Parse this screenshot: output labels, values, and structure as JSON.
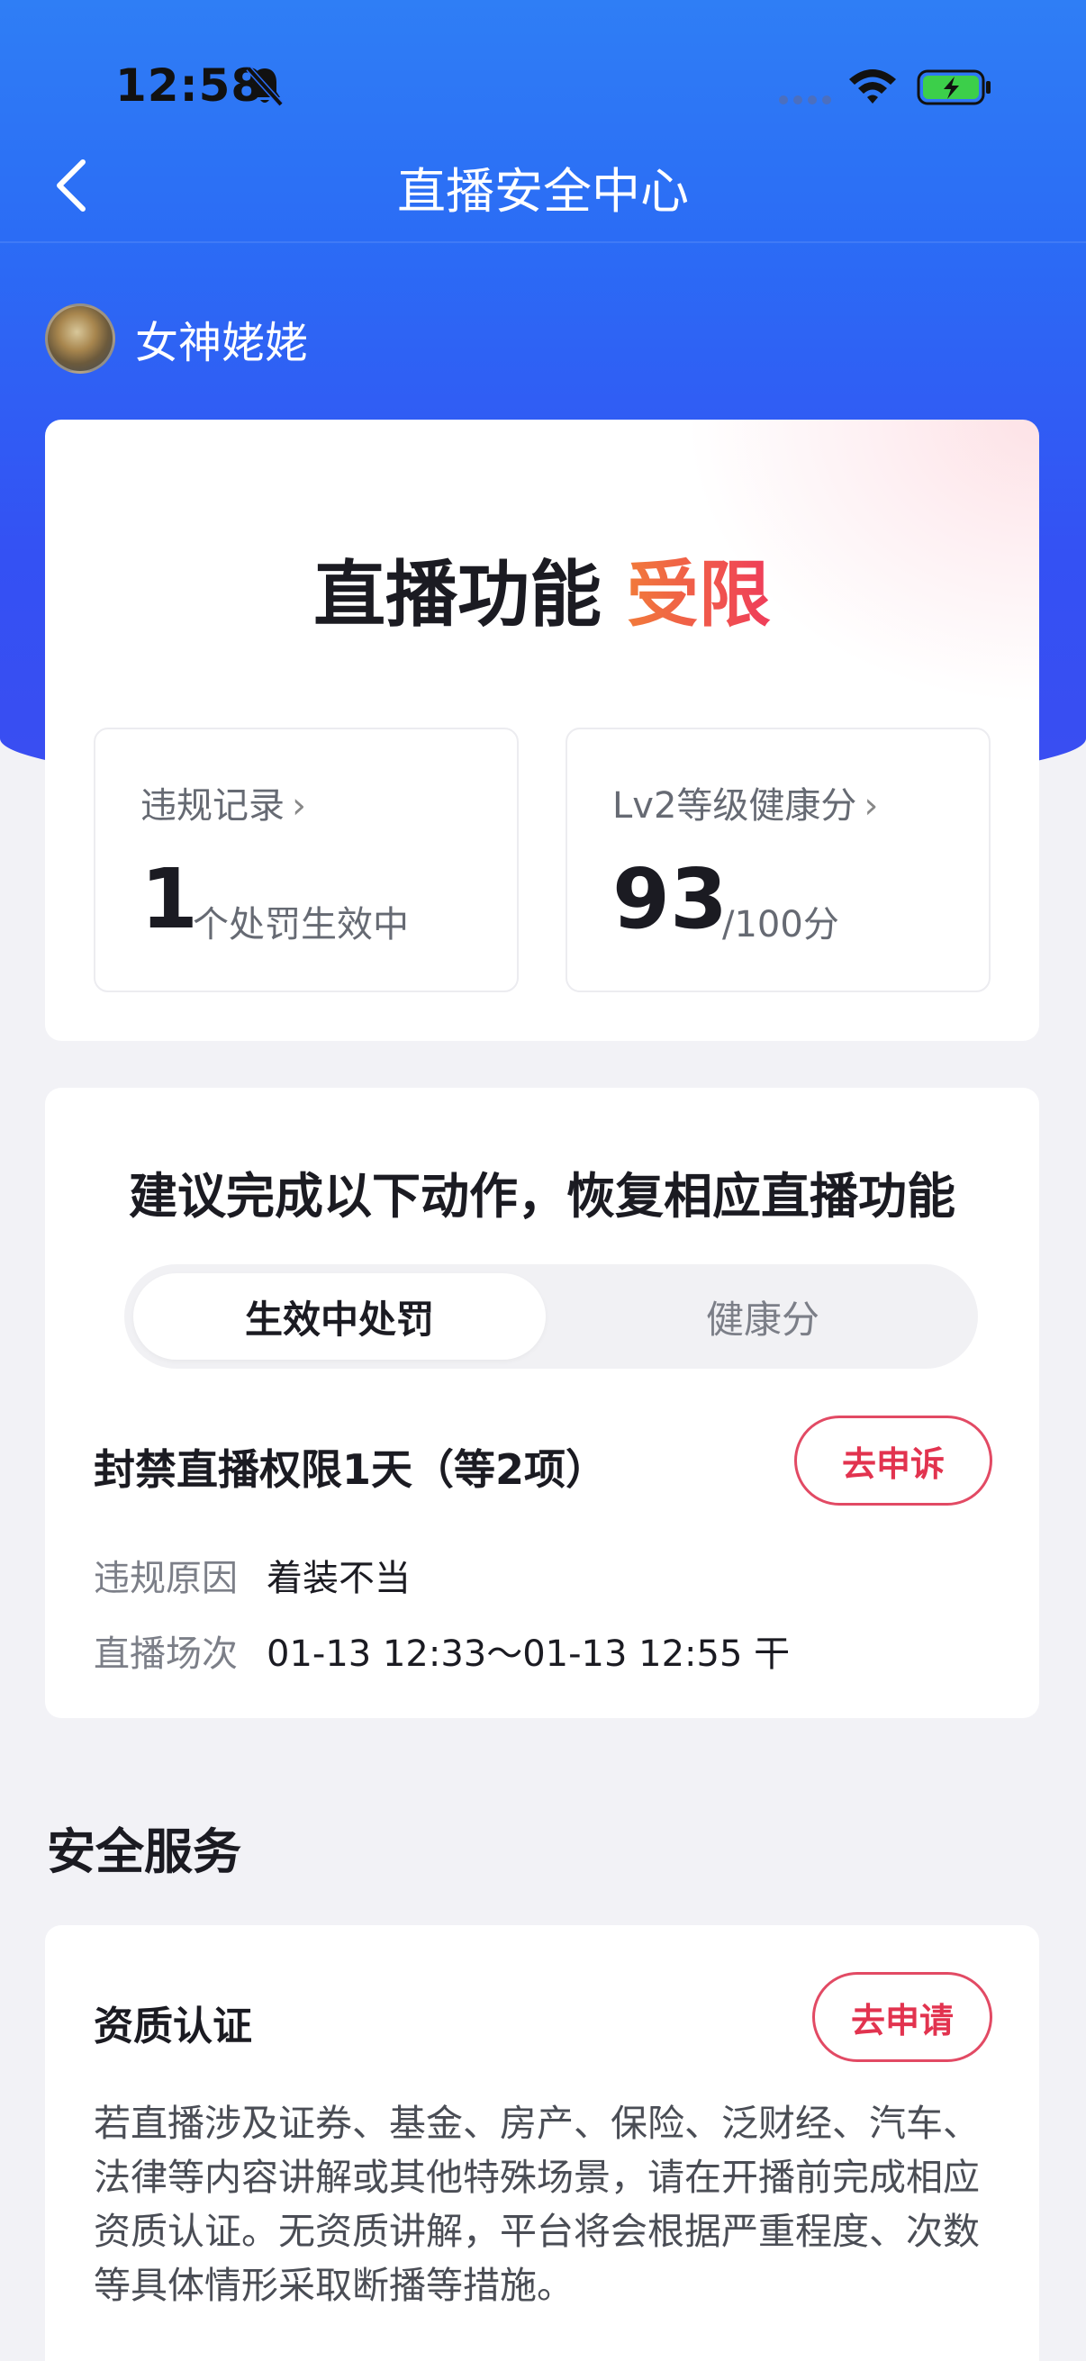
{
  "status_bar": {
    "time": "12:58"
  },
  "nav": {
    "title": "直播安全中心"
  },
  "user": {
    "name": "女神姥姥"
  },
  "status_card": {
    "title_prefix": "直播功能 ",
    "title_highlight": "受限",
    "violation": {
      "label": "违规记录",
      "chevron": "›",
      "count": "1",
      "unit": "个处罚生效中"
    },
    "health": {
      "label": "Lv2等级健康分",
      "chevron": "›",
      "score": "93",
      "unit": "/100分"
    }
  },
  "action_card": {
    "title": "建议完成以下动作，恢复相应直播功能",
    "tabs": [
      "生效中处罚",
      "健康分"
    ],
    "penalty": {
      "title": "封禁直播权限1天（等2项）",
      "appeal_label": "去申诉",
      "reason_key": "违规原因",
      "reason_value": "着装不当",
      "session_key": "直播场次",
      "session_value": "01-13 12:33～01-13 12:55 干"
    }
  },
  "services": {
    "section_title": "安全服务",
    "card": {
      "title": "资质认证",
      "apply_label": "去申请",
      "description": "若直播涉及证券、基金、房产、保险、泛财经、汽车、法律等内容讲解或其他特殊场景，请在开播前完成相应资质认证。无资质讲解，平台将会根据严重程度、次数等具体情形采取断播等措施。"
    }
  },
  "colors": {
    "brand_blue": "#2b6cf5",
    "accent_red": "#e2334f",
    "accent_orange": "#f17a3a"
  },
  "icons": [
    "back-arrow-icon",
    "bell-slash-icon",
    "signal-icon",
    "wifi-icon",
    "battery-charging-icon",
    "chevron-right-icon"
  ]
}
